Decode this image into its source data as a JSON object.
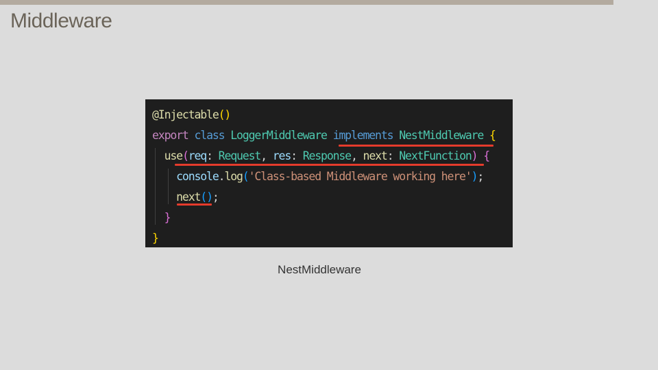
{
  "slide": {
    "title": "Middleware",
    "caption": "NestMiddleware"
  },
  "code": {
    "line1": {
      "decorator": "@Injectable",
      "open": "(",
      "close": ")"
    },
    "line2": {
      "kw_export": "export",
      "kw_class": "class",
      "class_name": "LoggerMiddleware",
      "kw_implements": "implements",
      "iface": "NestMiddleware",
      "brace": "{"
    },
    "line3": {
      "method": "use",
      "paren_open": "(",
      "p1": "req",
      "colon1": ": ",
      "t1": "Request",
      "comma1": ", ",
      "p2": "res",
      "colon2": ": ",
      "t2": "Response",
      "comma2": ", ",
      "p3": "next",
      "colon3": ": ",
      "t3": "NextFunction",
      "paren_close": ")",
      "brace": "{"
    },
    "line4": {
      "obj": "console",
      "dot": ".",
      "fn": "log",
      "paren_open": "(",
      "str": "'Class-based Middleware working here'",
      "paren_close": ")",
      "semi": ";"
    },
    "line5": {
      "fn": "next",
      "parens": "()",
      "semi": ";"
    },
    "line6": {
      "brace": "}"
    },
    "line7": {
      "brace": "}"
    }
  },
  "colors": {
    "underline": "#e53b2c",
    "code_background": "#1e1e1e",
    "slide_background": "#dcdcdc",
    "title": "#6b6459",
    "top_bar": "#b3aa9f"
  }
}
